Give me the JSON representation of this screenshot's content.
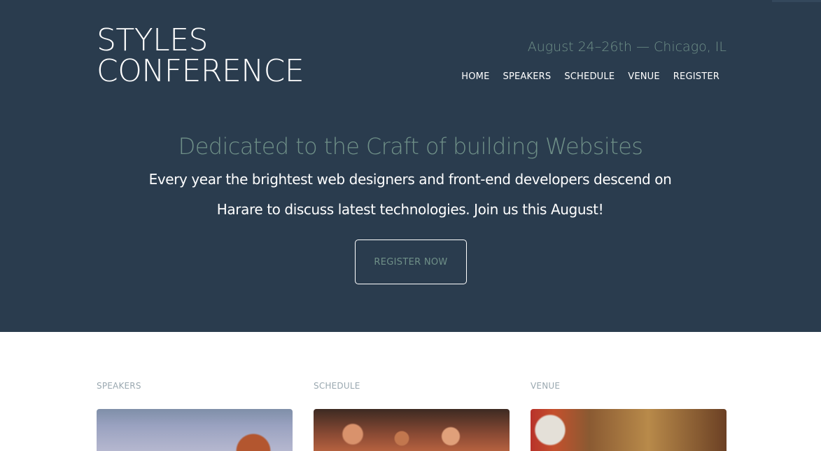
{
  "header": {
    "logo_line1": "STYLES",
    "logo_line2": "CONFERENCE",
    "event_info": "August 24–26th — Chicago, IL",
    "nav": [
      {
        "label": "HOME"
      },
      {
        "label": "SPEAKERS"
      },
      {
        "label": "SCHEDULE"
      },
      {
        "label": "VENUE"
      },
      {
        "label": "REGISTER"
      }
    ]
  },
  "hero": {
    "headline": "Dedicated to the Craft of building Websites",
    "lead": "Every year the brightest web designers and front-end developers descend on Harare to discuss latest technologies. Join us this August!",
    "cta_label": "REGISTER NOW"
  },
  "sections": [
    {
      "title": "SPEAKERS"
    },
    {
      "title": "SCHEDULE"
    },
    {
      "title": "VENUE"
    }
  ],
  "colors": {
    "hero_bg": "#2a3c4e",
    "accent": "#6f9088",
    "section_title": "#9aa8b0"
  }
}
